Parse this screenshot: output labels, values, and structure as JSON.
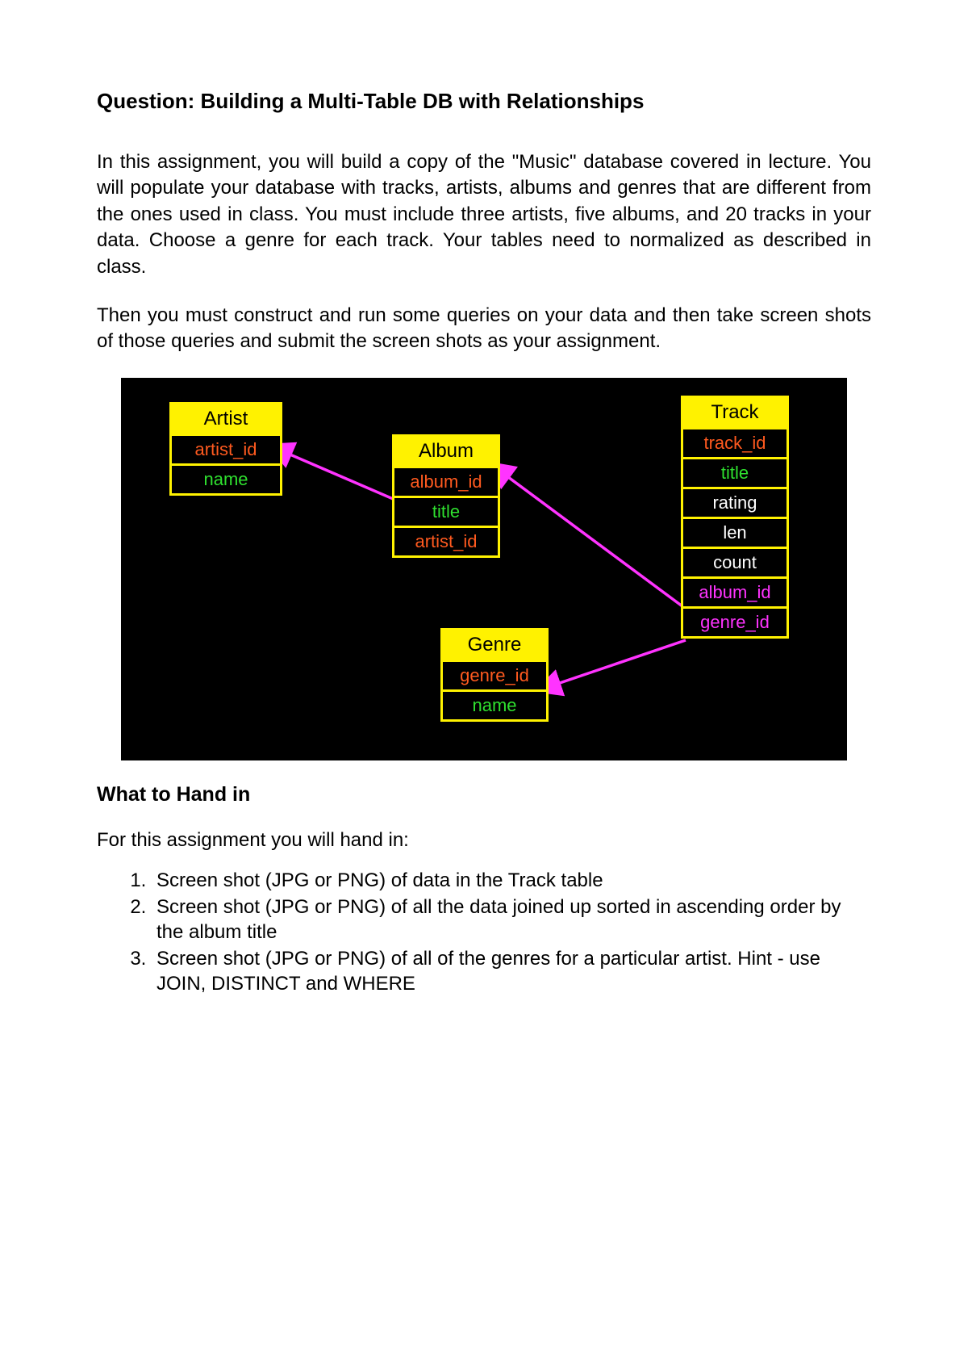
{
  "title": "Question: Building a Multi-Table DB with Relationships",
  "para1": "In this assignment, you will build a copy of the \"Music\" database covered in lecture. You will populate your database with tracks, artists, albums and genres that are different from the ones used in class. You must include three artists, five albums, and 20 tracks in your data. Choose a genre for each track. Your tables need to normalized as described in class.",
  "para2": "Then you must construct and run some queries on your data and then take screen shots of those queries and submit the screen shots as your assignment.",
  "tables": {
    "artist": {
      "header": "Artist",
      "fields": [
        {
          "text": "artist_id",
          "class": "pk"
        },
        {
          "text": "name",
          "class": "attr"
        }
      ]
    },
    "album": {
      "header": "Album",
      "fields": [
        {
          "text": "album_id",
          "class": "pk"
        },
        {
          "text": "title",
          "class": "attr"
        },
        {
          "text": "artist_id",
          "class": "pk"
        }
      ]
    },
    "genre": {
      "header": "Genre",
      "fields": [
        {
          "text": "genre_id",
          "class": "pk"
        },
        {
          "text": "name",
          "class": "attr"
        }
      ]
    },
    "track": {
      "header": "Track",
      "fields": [
        {
          "text": "track_id",
          "class": "pk"
        },
        {
          "text": "title",
          "class": "attr"
        },
        {
          "text": "rating",
          "class": "reg"
        },
        {
          "text": "len",
          "class": "reg"
        },
        {
          "text": "count",
          "class": "reg"
        },
        {
          "text": "album_id",
          "class": "fk"
        },
        {
          "text": "genre_id",
          "class": "fk"
        }
      ]
    }
  },
  "subheading": "What to Hand in",
  "lead": "For this assignment you will hand in:",
  "handin": [
    "Screen shot (JPG or PNG) of data in the Track table",
    "Screen shot (JPG or PNG) of all the data joined up sorted in ascending order by the album title",
    "Screen shot (JPG or PNG) of all of the genres for a particular artist. Hint - use JOIN, DISTINCT and WHERE"
  ]
}
